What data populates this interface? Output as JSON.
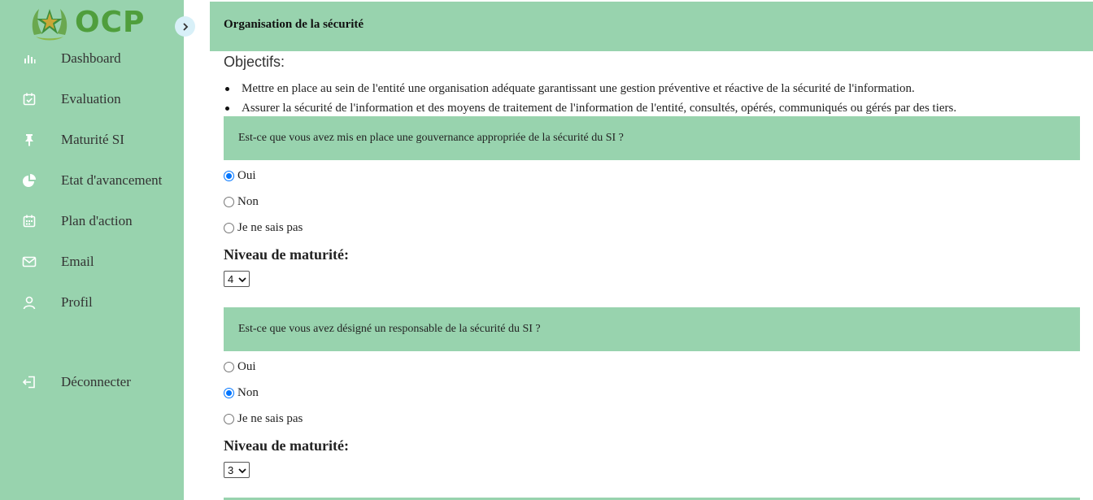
{
  "brand": {
    "logo_text": "OCP",
    "accent": "#98d3ae",
    "logo_green": "#4f9e3c"
  },
  "sidebar": {
    "items": [
      {
        "label": "Dashboard",
        "icon": "bar-chart-icon"
      },
      {
        "label": "Evaluation",
        "icon": "calendar-check-icon"
      },
      {
        "label": "Maturité SI",
        "icon": "pin-icon"
      },
      {
        "label": "Etat d'avancement",
        "icon": "pie-chart-icon"
      },
      {
        "label": "Plan d'action",
        "icon": "calendar-icon"
      },
      {
        "label": "Email",
        "icon": "mail-icon"
      },
      {
        "label": "Profil",
        "icon": "user-icon"
      },
      {
        "label": "Déconnecter",
        "icon": "logout-icon"
      }
    ]
  },
  "main": {
    "title": "Organisation de la sécurité",
    "objectifs_title": "Objectifs:",
    "objectifs": [
      "Mettre en place au sein de l'entité une organisation adéquate garantissant une gestion préventive et réactive de la sécurité de l'information.",
      "Assurer la sécurité de l'information et des moyens de traitement de l'information de l'entité, consultés, opérés, communiqués ou gérés par des tiers."
    ],
    "questions": [
      {
        "text": "Est-ce que vous avez mis en place une gouvernance appropriée de la sécurité du SI ?",
        "options": [
          "Oui",
          "Non",
          "Je ne sais pas"
        ],
        "selected": "Oui",
        "level_label": "Niveau de maturité:",
        "level_value": "4"
      },
      {
        "text": "Est-ce que vous avez désigné un responsable de la sécurité du SI ?",
        "options": [
          "Oui",
          "Non",
          "Je ne sais pas"
        ],
        "selected": "Non",
        "level_label": "Niveau de maturité:",
        "level_value": "3"
      }
    ]
  }
}
